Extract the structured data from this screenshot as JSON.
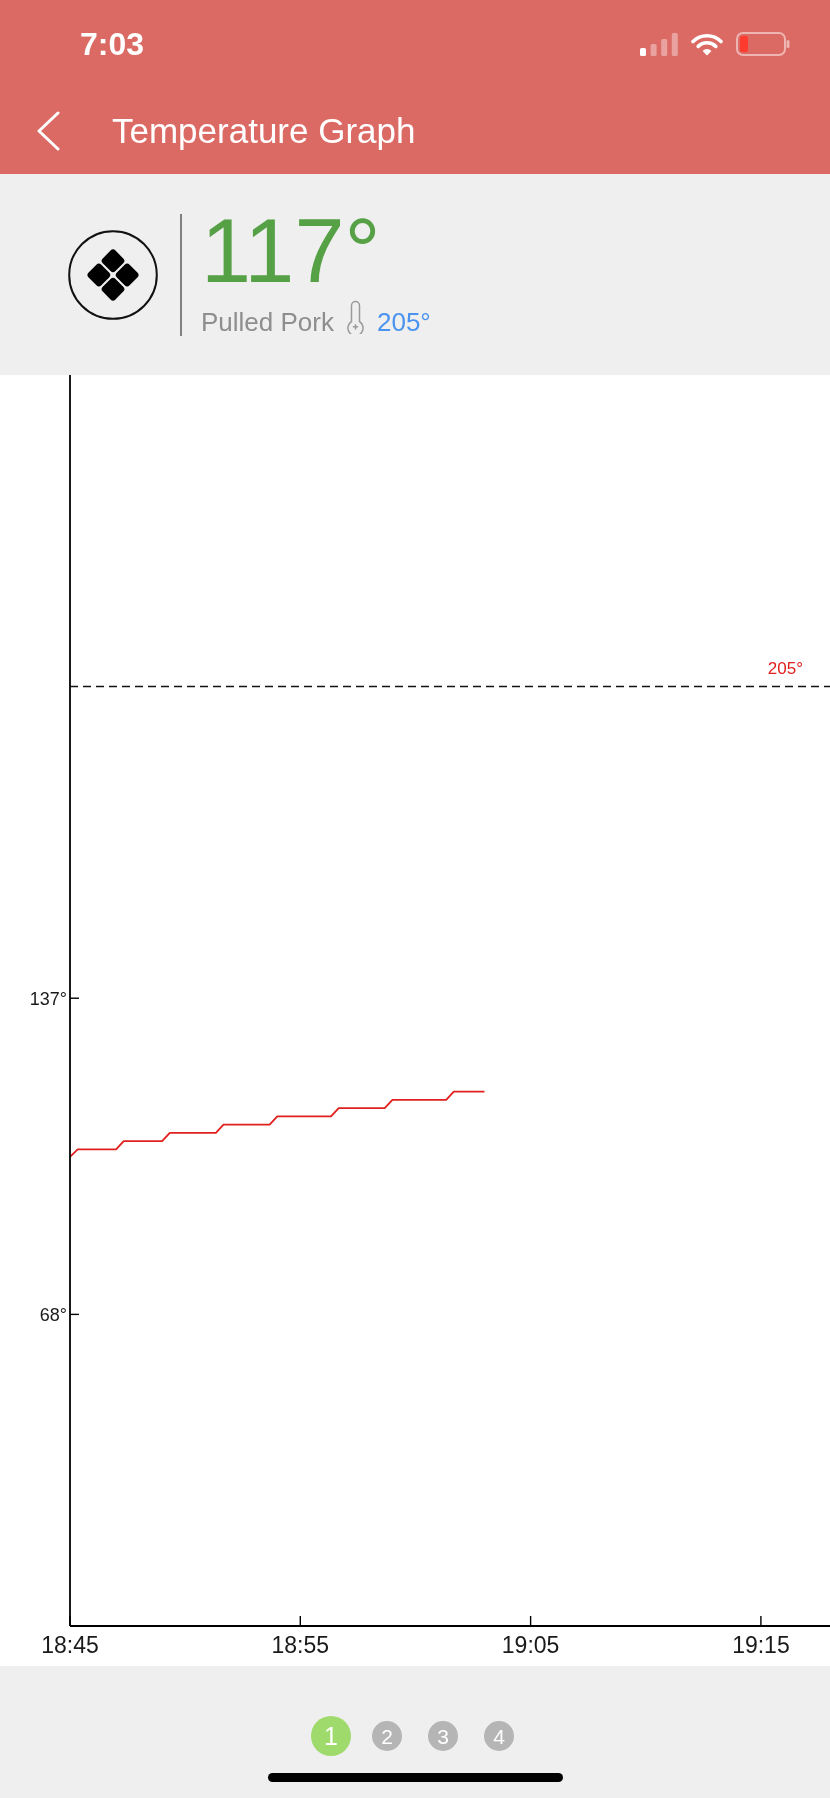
{
  "status_bar": {
    "time": "7:03"
  },
  "nav_bar": {
    "title": "Temperature Graph"
  },
  "probe": {
    "current_temp": "117°",
    "food": "Pulled Pork",
    "target_temp": "205°"
  },
  "chart": {
    "chart_data": {
      "type": "line",
      "categories": [
        "18:45",
        null,
        null,
        null,
        null,
        null,
        null,
        null,
        null,
        null,
        null,
        null,
        null,
        null,
        null,
        null,
        null,
        null,
        null,
        null,
        null,
        null,
        null,
        null,
        null,
        null,
        null,
        null,
        null,
        null,
        "18:55",
        null,
        null,
        null,
        null,
        null,
        null,
        null,
        null,
        null,
        null,
        null,
        null,
        null,
        null,
        null,
        null,
        null,
        null,
        null,
        null,
        null,
        null,
        null,
        null,
        null,
        null,
        null,
        null,
        null,
        "19:05",
        null,
        null,
        null,
        null,
        null,
        null,
        null,
        null,
        null,
        null,
        null,
        null,
        null,
        null,
        null,
        null,
        null,
        null,
        null,
        null,
        null,
        null,
        null,
        null,
        null,
        null,
        null,
        null,
        null,
        "19:15",
        null,
        null,
        null,
        null,
        null,
        null,
        null,
        null,
        null
      ],
      "series": [
        {
          "color": "#e0201e",
          "values": [
            102.4,
            104,
            104,
            104,
            104,
            104,
            104,
            105.8,
            105.8,
            105.8,
            105.8,
            105.8,
            105.8,
            107.6,
            107.6,
            107.6,
            107.6,
            107.6,
            107.6,
            107.6,
            109.4,
            109.4,
            109.4,
            109.4,
            109.4,
            109.4,
            109.4,
            111.2,
            111.2,
            111.2,
            111.2,
            111.2,
            111.2,
            111.2,
            111.2,
            113,
            113,
            113,
            113,
            113,
            113,
            113,
            114.8,
            114.8,
            114.8,
            114.8,
            114.8,
            114.8,
            114.8,
            114.8,
            116.6,
            116.6,
            116.6,
            116.6,
            116.6,
            null,
            null,
            null,
            null,
            null,
            null,
            null,
            null,
            null,
            null,
            null,
            null,
            null,
            null,
            null,
            null,
            null,
            null,
            null,
            null,
            null,
            null,
            null,
            null,
            null,
            null,
            null,
            null,
            null,
            null,
            null,
            null,
            null,
            null,
            null,
            null,
            null,
            null,
            null,
            null,
            null,
            null,
            null,
            null,
            null
          ]
        }
      ],
      "ylim": [
        0,
        273
      ],
      "yticks": [
        {
          "value": 68,
          "label": "68°"
        },
        {
          "value": 137,
          "label": "137°"
        }
      ],
      "ref_lines": [
        {
          "axis": "y",
          "value": 205,
          "label": "205°"
        }
      ]
    }
  },
  "pager": [
    {
      "label": "1",
      "selected": true
    },
    {
      "label": "2",
      "selected": false
    },
    {
      "label": "3",
      "selected": false
    },
    {
      "label": "4",
      "selected": false
    }
  ]
}
